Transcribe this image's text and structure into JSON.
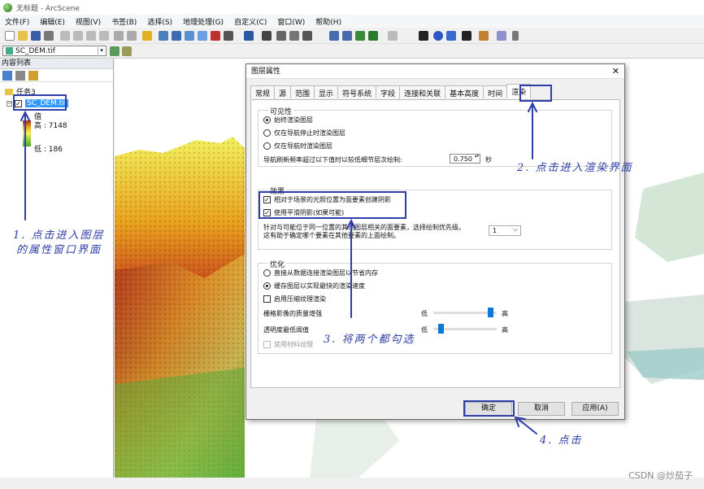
{
  "window": {
    "title": "无标题 - ArcScene"
  },
  "menu": [
    "文件(F)",
    "编辑(E)",
    "视图(V)",
    "书签(B)",
    "选择(S)",
    "地理处理(G)",
    "自定义(C)",
    "窗口(W)",
    "帮助(H)"
  ],
  "layer_select": {
    "value": "SC_DEM.tif"
  },
  "toc": {
    "title": "内容列表",
    "group": "任务3",
    "layer": "SC_DEM.tif",
    "value_label": "值",
    "high": "高 : 7148",
    "low": "低 : 186"
  },
  "dialog": {
    "title": "图层属性",
    "tabs": [
      "常规",
      "源",
      "范围",
      "显示",
      "符号系统",
      "字段",
      "连接和关联",
      "基本高度",
      "时间",
      "渲染"
    ],
    "active_tab": "渲染",
    "visibility": {
      "title": "可见性",
      "options": [
        "始终渲染图层",
        "仅在导航停止时渲染图层",
        "仅在导航时渲染图层"
      ],
      "selected": 0,
      "refresh_label": "导航刷新频率超过以下值时以较低细节层次绘制:",
      "refresh_value": "0.750",
      "refresh_unit": "秒"
    },
    "effects": {
      "title": "效果",
      "checks": [
        "相对于场景的光照位置为面要素创建阴影",
        "使用平滑阴影(如果可能)"
      ],
      "checked": [
        true,
        true
      ],
      "note_line1": "针对与可能位于同一位置的其他图层相关的面要素，选择绘制优先级。",
      "note_line2": "这有助于确定哪个要素在其他要素的上面绘制。",
      "priority_value": "1"
    },
    "optimize": {
      "title": "优化",
      "options": [
        "直接从数据连接渲染图层以节省内存",
        "缓存图层以实现最快的渲染速度"
      ],
      "selected": 1,
      "compress_label": "启用压缩纹理渲染",
      "quality_label": "栅格影像的质量增强",
      "transparency_label": "透明度最低阈值",
      "low": "低",
      "high": "高",
      "quality_level": 0.95,
      "transparency_level": 0.08,
      "disable_material_label": "禁用材料纹理"
    },
    "buttons": {
      "ok": "确定",
      "cancel": "取消",
      "apply": "应用(A)"
    }
  },
  "annotations": {
    "step1_line1": "1. 点击进入图层",
    "step1_line2": "的属性窗口界面",
    "step2": "2. 点击进入渲染界面",
    "step3": "3. 将两个都勾选",
    "step4": "4. 点击"
  },
  "watermark": "CSDN @炒茄子"
}
